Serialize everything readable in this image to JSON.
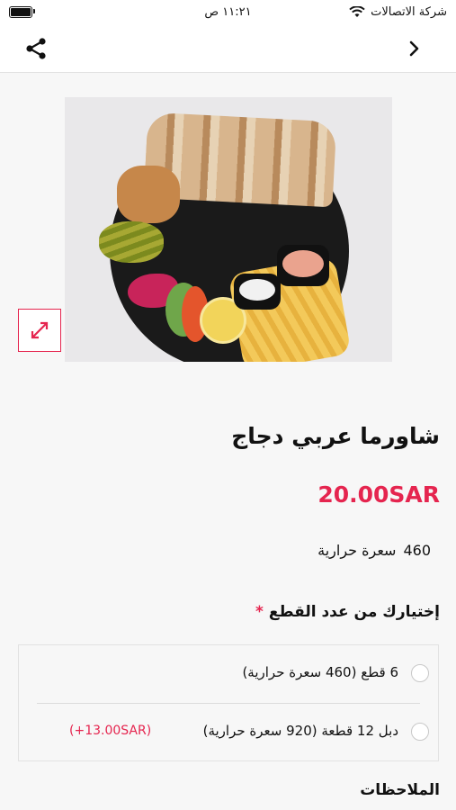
{
  "status_bar": {
    "carrier": "شركة الاتصالات",
    "time": "١١:٢١ ص"
  },
  "nav": {
    "share_icon": "share-icon",
    "back_icon": "chevron-right-icon"
  },
  "product": {
    "name": "شاورما عربي دجاج",
    "price": "20.00SAR",
    "calories_value": "460",
    "calories_label": "سعرة حرارية",
    "expand_icon": "expand-icon"
  },
  "options_section": {
    "title": "إختيارك من عدد القطع",
    "required_mark": "*",
    "options": [
      {
        "label": "6 قطع (460 سعرة حرارية)",
        "extra": "",
        "selected": false
      },
      {
        "label": "دبل 12 قطعة (920 سعرة حرارية)",
        "extra": "(+13.00SAR)",
        "selected": false
      }
    ]
  },
  "notes": {
    "title": "الملاحظات"
  },
  "colors": {
    "accent": "#e5254f",
    "background": "#f7f7f7"
  }
}
